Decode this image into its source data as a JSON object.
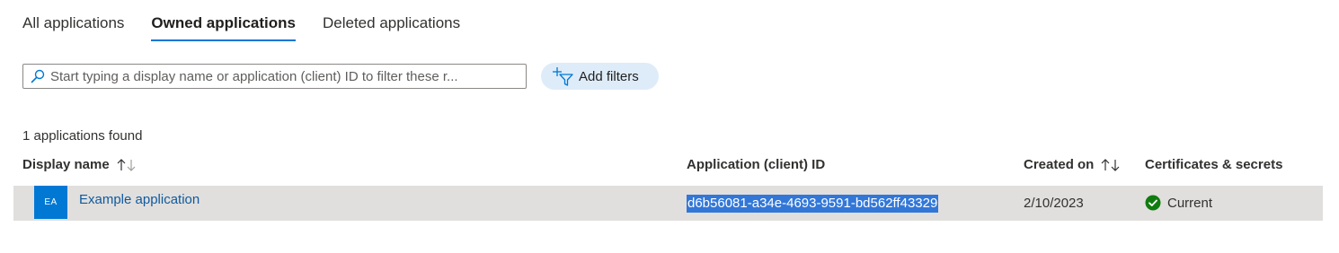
{
  "tabs": [
    {
      "label": "All applications"
    },
    {
      "label": "Owned applications"
    },
    {
      "label": "Deleted applications"
    }
  ],
  "search": {
    "placeholder": "Start typing a display name or application (client) ID to filter these r..."
  },
  "filters": {
    "add_label": "Add filters"
  },
  "results": {
    "count_text": "1 applications found"
  },
  "table": {
    "headers": {
      "display_name": "Display name",
      "client_id": "Application (client) ID",
      "created_on": "Created on",
      "certificates": "Certificates & secrets"
    },
    "rows": [
      {
        "avatar_initials": "EA",
        "display_name": "Example application",
        "client_id": "d6b56081-a34e-4693-9591-bd562ff43329",
        "created_on": "2/10/2023",
        "certificates_status": "Current"
      }
    ]
  },
  "colors": {
    "accent": "#0078d4",
    "avatar_bg": "#0078d4",
    "link": "#0f5a9e",
    "selection_highlight": "#3277d8",
    "row_selected_bg": "#e1dfdd",
    "filter_pill_bg": "#deecf9",
    "status_ok": "#107c10"
  },
  "icons": {
    "search": "search-icon",
    "add_filter": "add-filter-icon",
    "sort": "sort-icon",
    "status_ok": "check-circle-icon"
  }
}
